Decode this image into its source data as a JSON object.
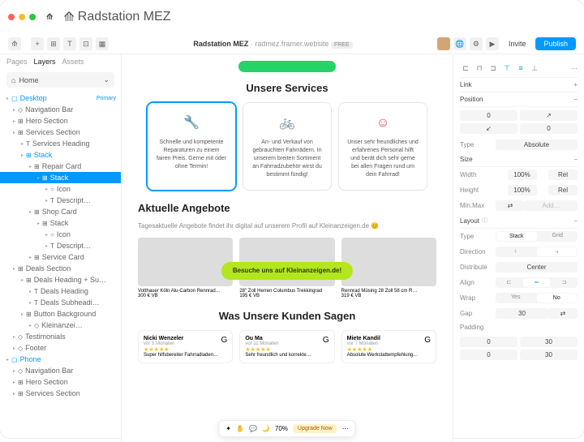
{
  "window": {
    "tab": "Radstation MEZ"
  },
  "breadcrumb": {
    "project": "Radstation MEZ",
    "url": "radmez.framer.website",
    "plan": "FREE"
  },
  "actions": {
    "invite": "Invite",
    "publish": "Publish"
  },
  "left": {
    "tabs": [
      "Pages",
      "Layers",
      "Assets"
    ],
    "home": "Home",
    "tree": [
      {
        "l": "Desktop",
        "d": 0,
        "tag": "Primary",
        "bl": true
      },
      {
        "l": "Navigation Bar",
        "d": 1,
        "i": "◇"
      },
      {
        "l": "Hero Section",
        "d": 1,
        "i": "⊞"
      },
      {
        "l": "Services Section",
        "d": 1,
        "i": "⊞"
      },
      {
        "l": "Services Heading",
        "d": 2,
        "i": "T"
      },
      {
        "l": "Stack",
        "d": 2,
        "i": "⊞",
        "bl": true
      },
      {
        "l": "Repair Card",
        "d": 3,
        "i": "⊞"
      },
      {
        "l": "Stack",
        "d": 4,
        "i": "⊞",
        "sel": true
      },
      {
        "l": "Icon",
        "d": 5,
        "i": "○"
      },
      {
        "l": "Descript…",
        "d": 5,
        "i": "T"
      },
      {
        "l": "Shop Card",
        "d": 3,
        "i": "⊞"
      },
      {
        "l": "Stack",
        "d": 4,
        "i": "⊞"
      },
      {
        "l": "Icon",
        "d": 5,
        "i": "○"
      },
      {
        "l": "Descript…",
        "d": 5,
        "i": "T"
      },
      {
        "l": "Service Card",
        "d": 3,
        "i": "⊞"
      },
      {
        "l": "Deals Section",
        "d": 1,
        "i": "⊞"
      },
      {
        "l": "Deals Heading + Su…",
        "d": 2,
        "i": "⊞"
      },
      {
        "l": "Deals Heading",
        "d": 3,
        "i": "T"
      },
      {
        "l": "Deals Subheadi…",
        "d": 3,
        "i": "T"
      },
      {
        "l": "Button Background",
        "d": 2,
        "i": "⊞"
      },
      {
        "l": "Kleinanzei…",
        "d": 3,
        "i": "◇"
      },
      {
        "l": "Testimonials",
        "d": 1,
        "i": "◇"
      },
      {
        "l": "Footer",
        "d": 1,
        "i": "◇"
      },
      {
        "l": "Phone",
        "d": 0,
        "bl": true
      },
      {
        "l": "Navigation Bar",
        "d": 1,
        "i": "◇"
      },
      {
        "l": "Hero Section",
        "d": 1,
        "i": "⊞"
      },
      {
        "l": "Services Section",
        "d": 1,
        "i": "⊞"
      }
    ]
  },
  "canvas": {
    "services_h": "Unsere Services",
    "cards": [
      "Schnelle und kompetente Reparaturen zu einem fairen Preis. Gerne mit oder ohne Termin!",
      "An- und Verkauf von gebrauchten Fahrrädern. In unserem breiten Sortiment an Fahrradzubehör wirst du bestimmt fündig!",
      "Unser sehr freundliches und erfahrenes Personal hilft und berät dich sehr gerne bei allen Fragen rund um dein Fahrrad!"
    ],
    "deals_h": "Aktuelle Angebote",
    "deals_sub": "Tagesaktuelle Angebote findet ihr digital auf unserem Profil auf Kleinanzeigen.de 😊",
    "pill": "Besuche uns auf Kleinanzeigen.de!",
    "offers": [
      {
        "t": "Votthauer Köln Alu-Carbon Rennrad…",
        "p": "300 € VB"
      },
      {
        "t": "28\" Zoll Herren Columbus Trekkingrad",
        "p": "195 € VB"
      },
      {
        "t": "Rennrad Müsing 28 Zoll 58 cm R…",
        "p": "319 € VB"
      }
    ],
    "reviews_h": "Was Unsere Kunden Sagen",
    "reviews": [
      {
        "n": "Nicki Wenzeler",
        "t": "vor 5 Monaten",
        "txt": "Super hilfsbereiter Fahrradladen…"
      },
      {
        "n": "Ou Ma",
        "t": "vor 11 Monaten",
        "txt": "Sehr freundlich und korrekte…"
      },
      {
        "n": "Miete Kandil",
        "t": "vor 7 Monaten",
        "txt": "Absolute Werkstattempfehlung…"
      }
    ],
    "bottombar": {
      "pct": "70%",
      "upgrade": "Upgrade Now"
    }
  },
  "inspector": {
    "link": "Link",
    "pos": {
      "h": "Position",
      "x": "0",
      "y": "0",
      "type_l": "Type",
      "type": "Absolute"
    },
    "size": {
      "h": "Size",
      "w_l": "Width",
      "w": "100%",
      "w_u": "Rel",
      "h_l": "Height",
      "ht": "100%",
      "h_u": "Rel",
      "mm_l": "Min.Max",
      "mm": "Add…"
    },
    "layout": {
      "h": "Layout",
      "type_l": "Type",
      "stack": "Stack",
      "grid": "Grid",
      "dir_l": "Direction",
      "dist_l": "Distribute",
      "dist": "Center",
      "align_l": "Align",
      "wrap_l": "Wrap",
      "yes": "Yes",
      "no": "No",
      "gap_l": "Gap",
      "gap": "30",
      "pad_l": "Padding",
      "pad": [
        "0",
        "30",
        "0",
        "30"
      ]
    }
  }
}
